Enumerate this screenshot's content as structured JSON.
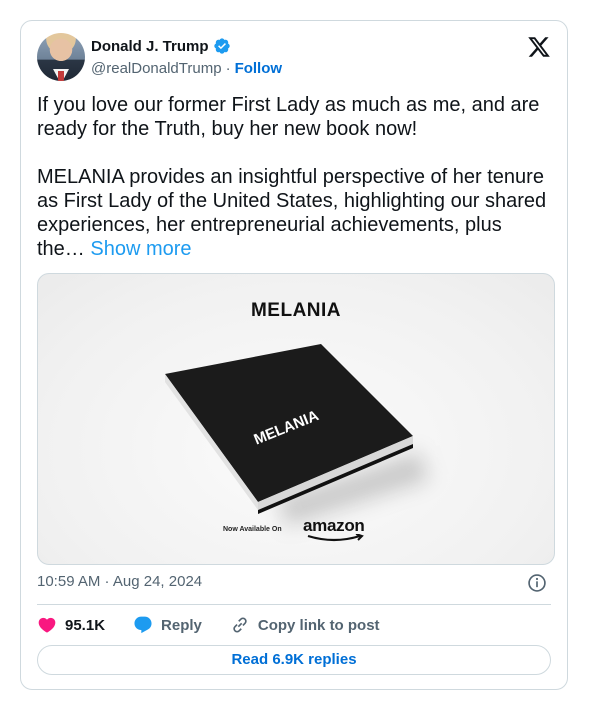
{
  "author": {
    "name": "Donald J. Trump",
    "handle": "@realDonaldTrump",
    "separator": "·",
    "follow_label": "Follow"
  },
  "tweet": {
    "paragraph1": "If you love our former First Lady as much as me, and are ready for the Truth, buy her new book now!",
    "paragraph2": "MELANIA provides an insightful perspective of her tenure as First Lady of the United States, highlighting our shared experiences, her entrepreneurial achievements, plus the…",
    "show_more_label": "Show more"
  },
  "media": {
    "title": "MELANIA",
    "book_cover_text": "MELANIA",
    "available_text": "Now Available On",
    "retailer": "amazon"
  },
  "timestamp": "10:59 AM · Aug 24, 2024",
  "actions": {
    "likes": "95.1K",
    "reply_label": "Reply",
    "copy_link_label": "Copy link to post"
  },
  "replies_button_label": "Read 6.9K replies",
  "colors": {
    "link_blue": "#1d9bf0",
    "follow_blue": "#006fd6",
    "like_pink": "#f91880",
    "reply_blue": "#1d9bf0",
    "muted": "#536471",
    "border": "#cfd9de"
  },
  "icons": {
    "verified": "verified-badge-icon",
    "x_logo": "x-logo-icon",
    "info": "info-icon",
    "like": "heart-icon",
    "reply": "speech-bubble-icon",
    "copy_link": "link-icon"
  }
}
